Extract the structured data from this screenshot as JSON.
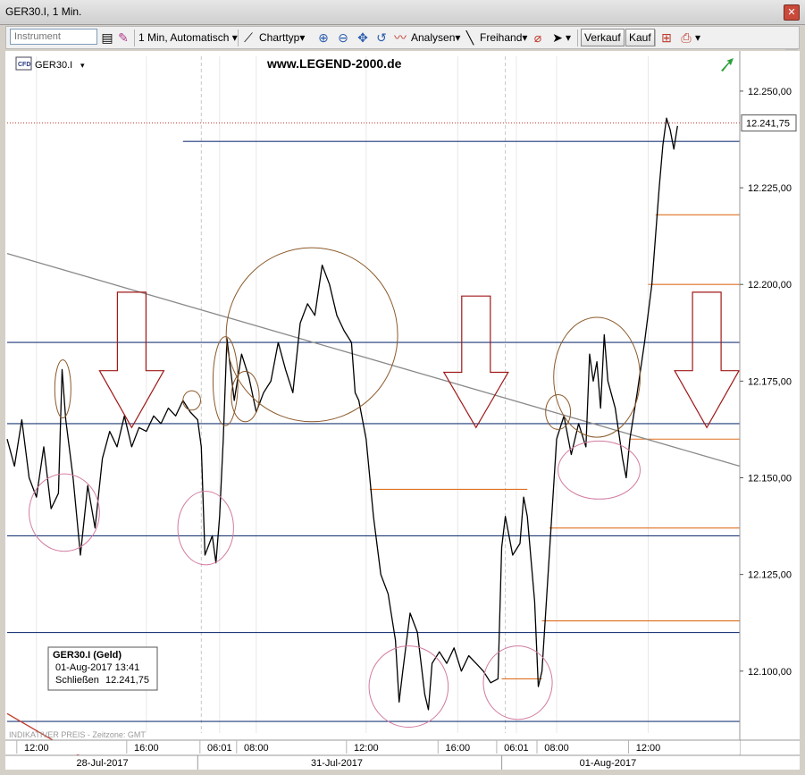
{
  "window": {
    "title": "GER30.I, 1 Min."
  },
  "toolbar": {
    "instrument_placeholder": "Instrument",
    "interval_label": "1 Min, Automatisch",
    "charttype_label": "Charttyp",
    "analysen_label": "Analysen",
    "freihand_label": "Freihand",
    "verkauf_label": "Verkauf",
    "kauf_label": "Kauf"
  },
  "chart_header": {
    "instrument_label": "GER30.I",
    "watermark": "www.LEGEND-2000.de",
    "cfd_badge": "CFD"
  },
  "info_box": {
    "title": "GER30.I (Geld)",
    "datetime": "01-Aug-2017 13:41",
    "close_label": "Schließen",
    "close_value": "12.241,75"
  },
  "footer_note": "INDIKATIVER PREIS - Zeitzone: GMT",
  "colors": {
    "price_line": "#000000",
    "support_line": "#1f3a78",
    "orange_line": "#e07020",
    "trend_line": "#8a8a8a",
    "arrow": "#a01818",
    "circle_brown": "#8b5a2b",
    "circle_pink": "#d27aa0",
    "current_price_line": "#c0392b"
  },
  "chart_data": {
    "type": "line",
    "y_axis": {
      "range": [
        12084,
        12259
      ],
      "tick_values": [
        12100,
        12125,
        12150,
        12175,
        12200,
        12225,
        12250
      ],
      "tick_labels": [
        "12.100,00",
        "12.125,00",
        "12.150,00",
        "12.175,00",
        "12.200,00",
        "12.225,00",
        "12.250,00"
      ]
    },
    "x_axis": {
      "slot_range": [
        0,
        100
      ],
      "time_ticks": [
        {
          "label": "12:00",
          "slot": 4
        },
        {
          "label": "16:00",
          "slot": 19
        },
        {
          "label": "06:01",
          "slot": 29
        },
        {
          "label": "08:00",
          "slot": 34
        },
        {
          "label": "12:00",
          "slot": 49
        },
        {
          "label": "16:00",
          "slot": 61.5
        },
        {
          "label": "06:01",
          "slot": 69.5
        },
        {
          "label": "08:00",
          "slot": 75
        },
        {
          "label": "12:00",
          "slot": 87.5
        }
      ],
      "date_labels": [
        {
          "label": "28-Jul-2017",
          "slot": 13
        },
        {
          "label": "31-Jul-2017",
          "slot": 45
        },
        {
          "label": "01-Aug-2017",
          "slot": 82
        }
      ],
      "session_breaks": [
        26.5,
        68
      ]
    },
    "current_price": {
      "value": 12241.75,
      "label": "12.241,75"
    },
    "series": [
      {
        "points": [
          [
            0,
            12160
          ],
          [
            1,
            12153
          ],
          [
            2,
            12165
          ],
          [
            3,
            12150
          ],
          [
            4,
            12145
          ],
          [
            5,
            12158
          ],
          [
            6,
            12142
          ],
          [
            7,
            12146
          ],
          [
            7.5,
            12178
          ],
          [
            8,
            12165
          ],
          [
            9,
            12150
          ],
          [
            10,
            12130
          ],
          [
            11,
            12148
          ],
          [
            12,
            12137
          ],
          [
            13,
            12155
          ],
          [
            14,
            12162
          ],
          [
            15,
            12158
          ],
          [
            16,
            12166
          ],
          [
            17,
            12158
          ],
          [
            18,
            12163
          ],
          [
            19,
            12162
          ],
          [
            20,
            12166
          ],
          [
            21,
            12164
          ],
          [
            22,
            12168
          ],
          [
            23,
            12166
          ],
          [
            24,
            12170
          ],
          [
            25,
            12167
          ],
          [
            26,
            12165
          ],
          [
            26.5,
            12158
          ],
          [
            27,
            12130
          ],
          [
            28,
            12135
          ],
          [
            28.5,
            12128
          ],
          [
            29,
            12140
          ],
          [
            29.5,
            12160
          ],
          [
            30,
            12186
          ],
          [
            30.5,
            12178
          ],
          [
            31,
            12170
          ],
          [
            32,
            12182
          ],
          [
            33,
            12176
          ],
          [
            34,
            12167
          ],
          [
            35,
            12172
          ],
          [
            36,
            12175
          ],
          [
            37,
            12185
          ],
          [
            38,
            12178
          ],
          [
            39,
            12172
          ],
          [
            40,
            12190
          ],
          [
            41,
            12195
          ],
          [
            42,
            12192
          ],
          [
            43,
            12205
          ],
          [
            44,
            12200
          ],
          [
            45,
            12192
          ],
          [
            46,
            12188
          ],
          [
            47,
            12185
          ],
          [
            47.5,
            12172
          ],
          [
            48,
            12170
          ],
          [
            49,
            12160
          ],
          [
            50,
            12140
          ],
          [
            51,
            12125
          ],
          [
            52,
            12120
          ],
          [
            53,
            12108
          ],
          [
            53.5,
            12092
          ],
          [
            54,
            12100
          ],
          [
            55,
            12115
          ],
          [
            56,
            12110
          ],
          [
            57,
            12094
          ],
          [
            57.5,
            12090
          ],
          [
            58,
            12102
          ],
          [
            59,
            12105
          ],
          [
            60,
            12102
          ],
          [
            61,
            12106
          ],
          [
            62,
            12100
          ],
          [
            63,
            12104
          ],
          [
            64,
            12102
          ],
          [
            65,
            12100
          ],
          [
            66,
            12097
          ],
          [
            67,
            12098
          ],
          [
            67.5,
            12132
          ],
          [
            68,
            12140
          ],
          [
            69,
            12130
          ],
          [
            70,
            12133
          ],
          [
            70.5,
            12145
          ],
          [
            71,
            12140
          ],
          [
            72,
            12118
          ],
          [
            72.5,
            12096
          ],
          [
            73,
            12100
          ],
          [
            73.5,
            12115
          ],
          [
            74,
            12130
          ],
          [
            75,
            12160
          ],
          [
            76,
            12166
          ],
          [
            77,
            12156
          ],
          [
            78,
            12164
          ],
          [
            79,
            12158
          ],
          [
            79.5,
            12182
          ],
          [
            80,
            12175
          ],
          [
            80.5,
            12180
          ],
          [
            81,
            12168
          ],
          [
            81.5,
            12187
          ],
          [
            82,
            12175
          ],
          [
            83,
            12168
          ],
          [
            84,
            12155
          ],
          [
            84.5,
            12150
          ],
          [
            85,
            12160
          ],
          [
            86,
            12172
          ],
          [
            87,
            12185
          ],
          [
            88,
            12200
          ],
          [
            89,
            12225
          ],
          [
            89.5,
            12236
          ],
          [
            90,
            12243
          ],
          [
            90.5,
            12240
          ],
          [
            91,
            12235
          ],
          [
            91.5,
            12241
          ]
        ]
      }
    ],
    "horizontal_lines": [
      {
        "value": 12237,
        "from": 24,
        "to": 100,
        "color_key": "support_line"
      },
      {
        "value": 12185,
        "from": 0,
        "to": 100,
        "color_key": "support_line"
      },
      {
        "value": 12164,
        "from": 0,
        "to": 100,
        "color_key": "support_line"
      },
      {
        "value": 12135,
        "from": 0,
        "to": 100,
        "color_key": "support_line"
      },
      {
        "value": 12110,
        "from": 0,
        "to": 100,
        "color_key": "support_line"
      },
      {
        "value": 12087,
        "from": 0,
        "to": 100,
        "color_key": "support_line"
      },
      {
        "value": 12218,
        "from": 88.5,
        "to": 100,
        "color_key": "orange_line"
      },
      {
        "value": 12200,
        "from": 87.5,
        "to": 100,
        "color_key": "orange_line"
      },
      {
        "value": 12160,
        "from": 85,
        "to": 100,
        "color_key": "orange_line"
      },
      {
        "value": 12147,
        "from": 49.5,
        "to": 71,
        "color_key": "orange_line"
      },
      {
        "value": 12137,
        "from": 74,
        "to": 100,
        "color_key": "orange_line"
      },
      {
        "value": 12113,
        "from": 73,
        "to": 100,
        "color_key": "orange_line"
      },
      {
        "value": 12098,
        "from": 67.5,
        "to": 73,
        "color_key": "orange_line"
      }
    ],
    "trend_lines": [
      {
        "from": [
          0,
          12208
        ],
        "to": [
          100,
          12153
        ],
        "color_key": "trend_line"
      },
      {
        "from": [
          0,
          12089
        ],
        "to": [
          10,
          12078
        ],
        "color_key": "current_price_line"
      }
    ],
    "down_arrows": [
      {
        "slot": 17,
        "top": 12198,
        "tip": 12163
      },
      {
        "slot": 64,
        "top": 12197,
        "tip": 12163
      },
      {
        "slot": 95.5,
        "top": 12198,
        "tip": 12163
      }
    ],
    "circles": [
      {
        "cx": 7.6,
        "cy": 12173,
        "rx": 1.1,
        "ry": 7.5,
        "color_key": "circle_brown"
      },
      {
        "cx": 7.8,
        "cy": 12141,
        "rx": 4.8,
        "ry": 10,
        "color_key": "circle_pink"
      },
      {
        "cx": 25.2,
        "cy": 12170,
        "rx": 1.2,
        "ry": 2.5,
        "color_key": "circle_brown"
      },
      {
        "cx": 27.1,
        "cy": 12137,
        "rx": 3.8,
        "ry": 9.5,
        "color_key": "circle_pink"
      },
      {
        "cx": 29.8,
        "cy": 12175,
        "rx": 1.7,
        "ry": 11.5,
        "color_key": "circle_brown"
      },
      {
        "cx": 32.5,
        "cy": 12171,
        "rx": 1.9,
        "ry": 6.5,
        "color_key": "circle_brown"
      },
      {
        "cx": 41.6,
        "cy": 12187,
        "rx": 11.7,
        "ry": 22.5,
        "color_key": "circle_brown"
      },
      {
        "cx": 54.8,
        "cy": 12096,
        "rx": 5.4,
        "ry": 10.5,
        "color_key": "circle_pink"
      },
      {
        "cx": 69.7,
        "cy": 12097,
        "rx": 4.7,
        "ry": 9.5,
        "color_key": "circle_pink"
      },
      {
        "cx": 75.2,
        "cy": 12167,
        "rx": 1.7,
        "ry": 4.5,
        "color_key": "circle_brown"
      },
      {
        "cx": 80.5,
        "cy": 12176,
        "rx": 5.9,
        "ry": 15.5,
        "color_key": "circle_brown"
      },
      {
        "cx": 80.8,
        "cy": 12152,
        "rx": 5.6,
        "ry": 7.5,
        "color_key": "circle_pink"
      }
    ]
  }
}
